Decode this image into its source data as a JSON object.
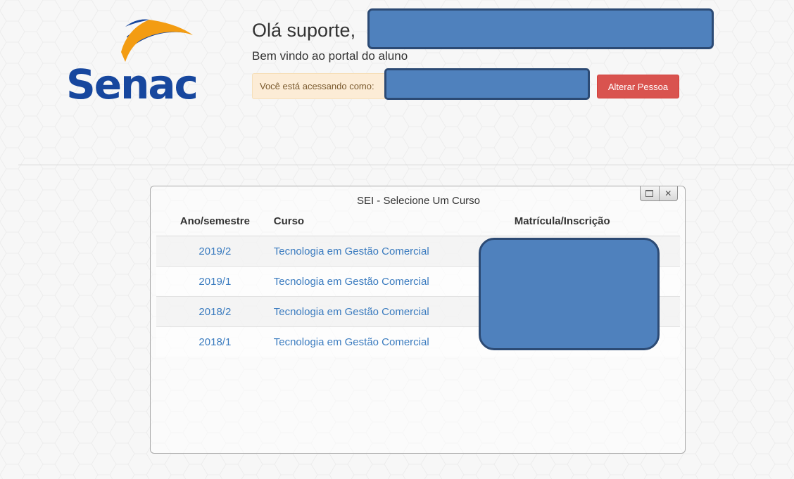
{
  "header": {
    "logo_text": "Senac",
    "greeting": "Olá suporte,",
    "welcome": "Bem vindo ao portal do aluno",
    "access_label": "Você está acessando como:",
    "alter_button": "Alterar Pessoa"
  },
  "dialog": {
    "title": "SEI - Selecione Um Curso",
    "controls": [
      "maximize-icon",
      "close-icon"
    ],
    "columns": [
      "Ano/semestre",
      "Curso",
      "Matrícula/Inscrição"
    ],
    "rows": [
      {
        "period": "2019/2",
        "course": "Tecnologia em Gestão Comercial"
      },
      {
        "period": "2019/1",
        "course": "Tecnologia em Gestão Comercial"
      },
      {
        "period": "2018/2",
        "course": "Tecnologia em Gestão Comercial"
      },
      {
        "period": "2018/1",
        "course": "Tecnologia em Gestão Comercial"
      }
    ]
  },
  "colors": {
    "brand_blue": "#17479e",
    "brand_orange": "#f39c12",
    "link": "#3a7bbf",
    "danger_button": "#d9534f",
    "access_bar_bg": "#fcecd6",
    "redaction": "#4f81bd"
  }
}
